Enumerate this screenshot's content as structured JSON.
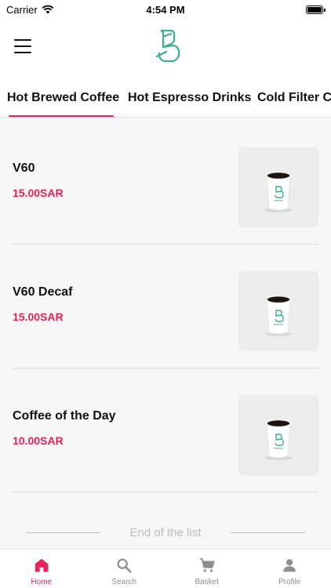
{
  "status": {
    "carrier": "Carrier",
    "time": "4:54 PM"
  },
  "tabs": [
    {
      "label": "Hot Brewed Coffee",
      "active": true
    },
    {
      "label": "Hot Espresso Drinks",
      "active": false
    },
    {
      "label": "Cold Filter Coffee",
      "active": false
    }
  ],
  "products": [
    {
      "name": "V60",
      "price": "15.00SAR"
    },
    {
      "name": "V60 Decaf",
      "price": "15.00SAR"
    },
    {
      "name": "Coffee of the Day",
      "price": "10.00SAR"
    }
  ],
  "end_text": "End of the list",
  "bottom_nav": [
    {
      "label": "Home",
      "icon": "home-icon",
      "active": true
    },
    {
      "label": "Search",
      "icon": "search-icon",
      "active": false
    },
    {
      "label": "Basket",
      "icon": "cart-icon",
      "active": false
    },
    {
      "label": "Profile",
      "icon": "person-icon",
      "active": false
    }
  ],
  "colors": {
    "accent": "#e8245c",
    "logo": "#3fae8c"
  }
}
